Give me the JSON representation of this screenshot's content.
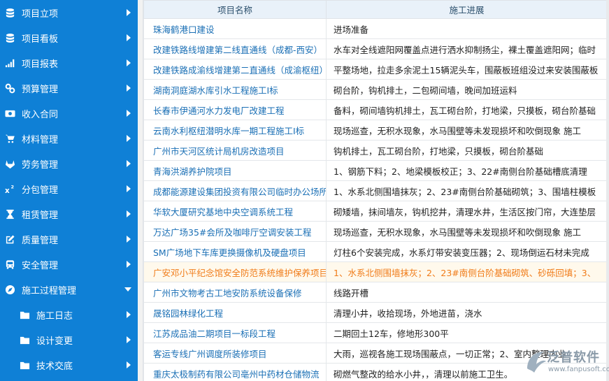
{
  "sidebar": {
    "items": [
      {
        "label": "项目立项",
        "icon": "database-icon"
      },
      {
        "label": "项目看板",
        "icon": "database-icon"
      },
      {
        "label": "项目报表",
        "icon": "signal-bars-icon"
      },
      {
        "label": "预算管理",
        "icon": "link-icon"
      },
      {
        "label": "收入合同",
        "icon": "money-icon"
      },
      {
        "label": "材料管理",
        "icon": "cart-icon"
      },
      {
        "label": "劳务管理",
        "icon": "gitlab-icon"
      },
      {
        "label": "分包管理",
        "icon": "superscript-icon"
      },
      {
        "label": "租赁管理",
        "icon": "hourglass-icon"
      },
      {
        "label": "质量管理",
        "icon": "edit-icon"
      },
      {
        "label": "安全管理",
        "icon": "bus-icon"
      },
      {
        "label": "施工过程管理",
        "icon": "compass-icon"
      }
    ],
    "subitems": [
      {
        "label": "施工日志",
        "icon": "folder-icon"
      },
      {
        "label": "设计变更",
        "icon": "folder-icon"
      },
      {
        "label": "技术交底",
        "icon": "folder-icon"
      }
    ]
  },
  "table": {
    "headers": [
      "项目名称",
      "施工进展"
    ],
    "rows": [
      {
        "name": "珠海鹤港口建设",
        "progress": "进场准备"
      },
      {
        "name": "改建铁路线增建第二线直通线（成都-西安）",
        "progress": "水车对全线遮阳网覆盖点进行洒水抑制扬尘，裸土覆盖遮阳网；临时"
      },
      {
        "name": "改建铁路成渝线增建第二直通线（成渝枢纽）",
        "progress": "平整场地，拉走多余泥土15辆泥头车，围蔽板班组没过来安装围蔽板"
      },
      {
        "name": "湖南洞庭湖水库引水工程施工I标",
        "progress": "砌台阶，钩机排土，二包砌间墙，晚间加班运料"
      },
      {
        "name": "长春市伊通河水力发电厂改建工程",
        "progress": "备料，砌间墙钩机排土，瓦工砌台阶，打地梁，只摸板，砌台阶基础"
      },
      {
        "name": "云南水利枢纽潜明水库一期工程施工I标",
        "progress": "现场巡查，无积水现象，水马围壁等未发现损坏和吹倒现象 施工"
      },
      {
        "name": "广州市天河区统计局机房改造项目",
        "progress": "钩机排土，瓦工砌台阶，打地梁，只摸板，砌台阶基础"
      },
      {
        "name": "青海洪湖养护院项目",
        "progress": "1、钢筋下料；2、地梁模板校正；3、22#南侧台阶基础槽底清理"
      },
      {
        "name": "成都能源建设集团投资有限公司临时办公场所",
        "progress": "1、水系北侧围墙抹灰；2、23#南侧台阶基础砌筑；3、围墙柱模板"
      },
      {
        "name": "华软大厦研究基地中央空调系统工程",
        "progress": "砌矮墙，抹间墙灰，钩机挖井，清理水井，生活区按门帘，大连垫层"
      },
      {
        "name": "万达广场35#会所及咖啡厅空调安装工程",
        "progress": "现场巡查，无积水现象，水马围壁等未发现损坏和吹倒现象 施工"
      },
      {
        "name": "SM广场地下车库更换摄像机及硬盘项目",
        "progress": "灯柱6个安装完成，水系灯带安装变压器；2、现场倒运石材未完成"
      },
      {
        "name": "广安邓小平纪念馆安全防范系统维护保养项目",
        "progress": "1、水系北侧围墙抹灰；2、23#南侧台阶基础砌筑、砂砾回填；3、"
      },
      {
        "name": "广州市文物考古工地安防系统设备保修",
        "progress": "线路开槽"
      },
      {
        "name": "晟铭园林绿化工程",
        "progress": "清理小井，收拾现场，外地进苗，浇水"
      },
      {
        "name": "江苏成品油二期项目一标段工程",
        "progress": "二期回土12车，修地形300平"
      },
      {
        "name": "客运专线广州调度所装修项目",
        "progress": "大雨，巡视各施工现场围蔽点，一切正常；2、室内整理内业"
      },
      {
        "name": "重庆太极制药有限公司亳州中药材仓储物流",
        "progress": "砌燃气整改的给水小井，，清理以前施工卫生。"
      }
    ],
    "highlighted_row": 12
  },
  "watermark": {
    "text": "泛普软件",
    "url": "www.fanpusoft.com"
  },
  "colors": {
    "sidebar": "#0f80d6",
    "link": "#1a6fb5",
    "highlight": "#f07b18",
    "header_bg": "#e9f1f9"
  }
}
